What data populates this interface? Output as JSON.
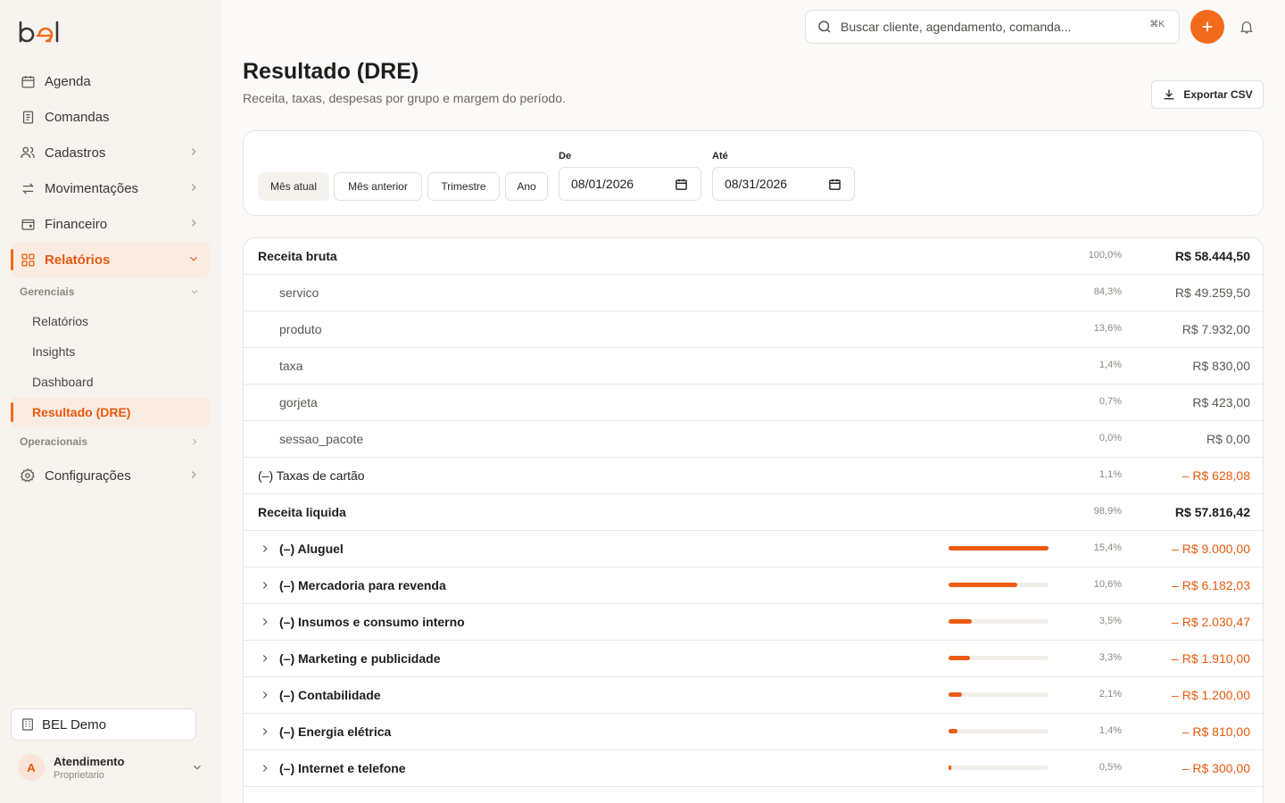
{
  "brand": "bel",
  "colors": {
    "accent": "#f26a1b",
    "negative": "#e8590c"
  },
  "sidebar": {
    "items": [
      {
        "label": "Agenda",
        "icon": "calendar-icon"
      },
      {
        "label": "Comandas",
        "icon": "receipt-icon"
      },
      {
        "label": "Cadastros",
        "icon": "users-icon"
      },
      {
        "label": "Movimentações",
        "icon": "arrows-icon"
      },
      {
        "label": "Financeiro",
        "icon": "wallet-icon"
      },
      {
        "label": "Relatórios",
        "icon": "grid-icon"
      }
    ],
    "section_gerenciais": "Gerenciais",
    "sub_items": [
      "Relatórios",
      "Insights",
      "Dashboard",
      "Resultado (DRE)"
    ],
    "section_operacionais": "Operacionais",
    "config_label": "Configurações",
    "org": "BEL Demo",
    "user": {
      "initial": "A",
      "name": "Atendimento",
      "role": "Proprietario"
    }
  },
  "topbar": {
    "search_placeholder": "Buscar cliente, agendamento, comanda...",
    "shortcut": "⌘K"
  },
  "header": {
    "title": "Resultado (DRE)",
    "subtitle": "Receita, taxas, despesas por grupo e margem do período.",
    "export_label": "Exportar CSV"
  },
  "filters": {
    "chips": [
      "Mês atual",
      "Mês anterior",
      "Trimestre",
      "Ano"
    ],
    "from_label": "De",
    "from_value": "08/01/2026",
    "to_label": "Até",
    "to_value": "08/31/2026"
  },
  "dre": {
    "rows": [
      {
        "label": "Receita bruta",
        "pct": "100,0%",
        "value": "R$ 58.444,50"
      },
      {
        "label": "servico",
        "pct": "84,3%",
        "value": "R$ 49.259,50"
      },
      {
        "label": "produto",
        "pct": "13,6%",
        "value": "R$ 7.932,00"
      },
      {
        "label": "taxa",
        "pct": "1,4%",
        "value": "R$ 830,00"
      },
      {
        "label": "gorjeta",
        "pct": "0,7%",
        "value": "R$ 423,00"
      },
      {
        "label": "sessao_pacote",
        "pct": "0,0%",
        "value": "R$ 0,00"
      },
      {
        "label": "(–) Taxas de cartão",
        "pct": "1,1%",
        "value": "– R$ 628,08"
      },
      {
        "label": "Receita liquida",
        "pct": "98,9%",
        "value": "R$ 57.816,42"
      },
      {
        "label": "(–) Aluguel",
        "pct": "15,4%",
        "value": "– R$ 9.000,00",
        "bar": 1.0
      },
      {
        "label": "(–) Mercadoria para revenda",
        "pct": "10,6%",
        "value": "– R$ 6.182,03",
        "bar": 0.69
      },
      {
        "label": "(–) Insumos e consumo interno",
        "pct": "3,5%",
        "value": "– R$ 2.030,47",
        "bar": 0.23
      },
      {
        "label": "(–) Marketing e publicidade",
        "pct": "3,3%",
        "value": "– R$ 1.910,00",
        "bar": 0.21
      },
      {
        "label": "(–) Contabilidade",
        "pct": "2,1%",
        "value": "– R$ 1.200,00",
        "bar": 0.13
      },
      {
        "label": "(–) Energia elétrica",
        "pct": "1,4%",
        "value": "– R$ 810,00",
        "bar": 0.09
      },
      {
        "label": "(–) Internet e telefone",
        "pct": "0,5%",
        "value": "– R$ 300,00",
        "bar": 0.03
      }
    ]
  }
}
